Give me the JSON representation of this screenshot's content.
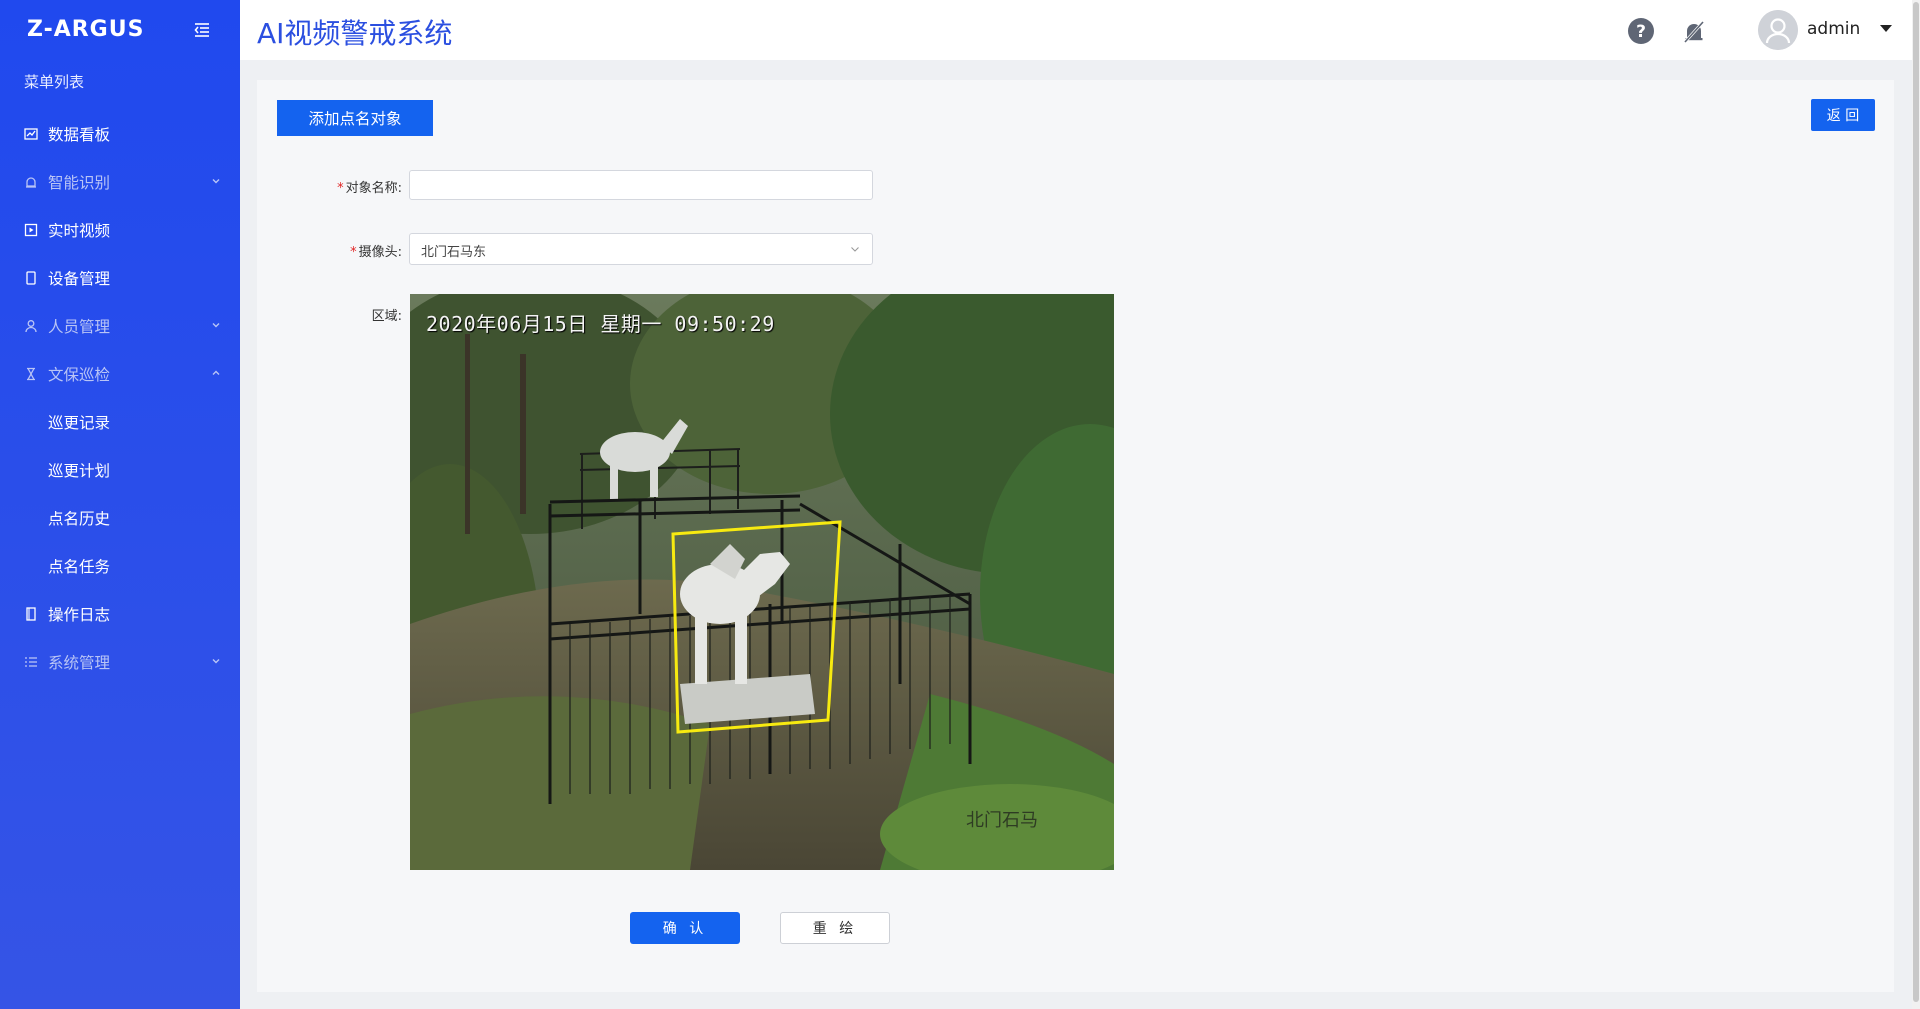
{
  "sidebar": {
    "logo": "Z-ARGUS",
    "menu_title": "菜单列表",
    "items": [
      {
        "label": "数据看板",
        "icon": "chart-icon",
        "dim": false,
        "chevron": ""
      },
      {
        "label": "智能识别",
        "icon": "alarm-icon",
        "dim": true,
        "chevron": "down"
      },
      {
        "label": "实时视频",
        "icon": "video-icon",
        "dim": false,
        "chevron": ""
      },
      {
        "label": "设备管理",
        "icon": "device-icon",
        "dim": false,
        "chevron": ""
      },
      {
        "label": "人员管理",
        "icon": "user-icon",
        "dim": true,
        "chevron": "down"
      },
      {
        "label": "文保巡检",
        "icon": "hourglass-icon",
        "dim": true,
        "chevron": "up"
      }
    ],
    "subitems": [
      "巡更记录",
      "巡更计划",
      "点名历史",
      "点名任务"
    ],
    "items_after": [
      {
        "label": "操作日志",
        "icon": "log-icon",
        "dim": false,
        "chevron": ""
      },
      {
        "label": "系统管理",
        "icon": "list-icon",
        "dim": true,
        "chevron": "down"
      }
    ]
  },
  "header": {
    "title": "AI视频警戒系统",
    "username": "admin"
  },
  "main": {
    "add_button": "添加点名对象",
    "back_button": "返 回",
    "form": {
      "name_label": "对象名称:",
      "name_value": "",
      "camera_label": "摄像头:",
      "camera_value": "北门石马东",
      "area_label": "区域:"
    },
    "video": {
      "timestamp": "2020年06月15日 星期一 09:50:29",
      "camera_osd": "北门石马"
    },
    "confirm_button": "确 认",
    "redraw_button": "重 绘"
  },
  "colors": {
    "accent": "#1463ef",
    "sidebar": "#2049ee",
    "title": "#2b4fe0",
    "roi": "#f7ea10"
  }
}
